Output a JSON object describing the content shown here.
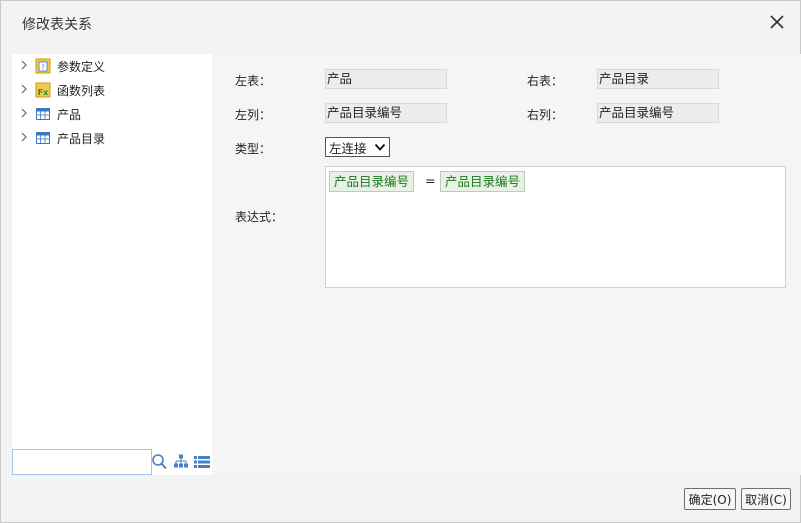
{
  "dialog": {
    "title": "修改表关系"
  },
  "tree": {
    "items": [
      {
        "label": "参数定义",
        "icon": "parameter-icon"
      },
      {
        "label": "函数列表",
        "icon": "function-icon"
      },
      {
        "label": "产品",
        "icon": "table-icon"
      },
      {
        "label": "产品目录",
        "icon": "table-icon"
      }
    ],
    "search_value": ""
  },
  "form": {
    "left_table_label": "左表：",
    "left_table_value": "产品",
    "right_table_label": "右表：",
    "right_table_value": "产品目录",
    "left_column_label": "左列：",
    "left_column_value": "产品目录编号",
    "right_column_label": "右列：",
    "right_column_value": "产品目录编号",
    "type_label": "类型：",
    "type_value": "左连接",
    "expression_label": "表达式："
  },
  "expression": {
    "left_token": "产品目录编号",
    "operator": "=",
    "right_token": "产品目录编号"
  },
  "buttons": {
    "ok": "确定(O)",
    "cancel": "取消(C)"
  },
  "colors": {
    "token_text": "#1a7a1a",
    "token_bg": "#e8f1e6",
    "table_icon": "#3a78c2",
    "folder_icon": "#f2c94c"
  }
}
